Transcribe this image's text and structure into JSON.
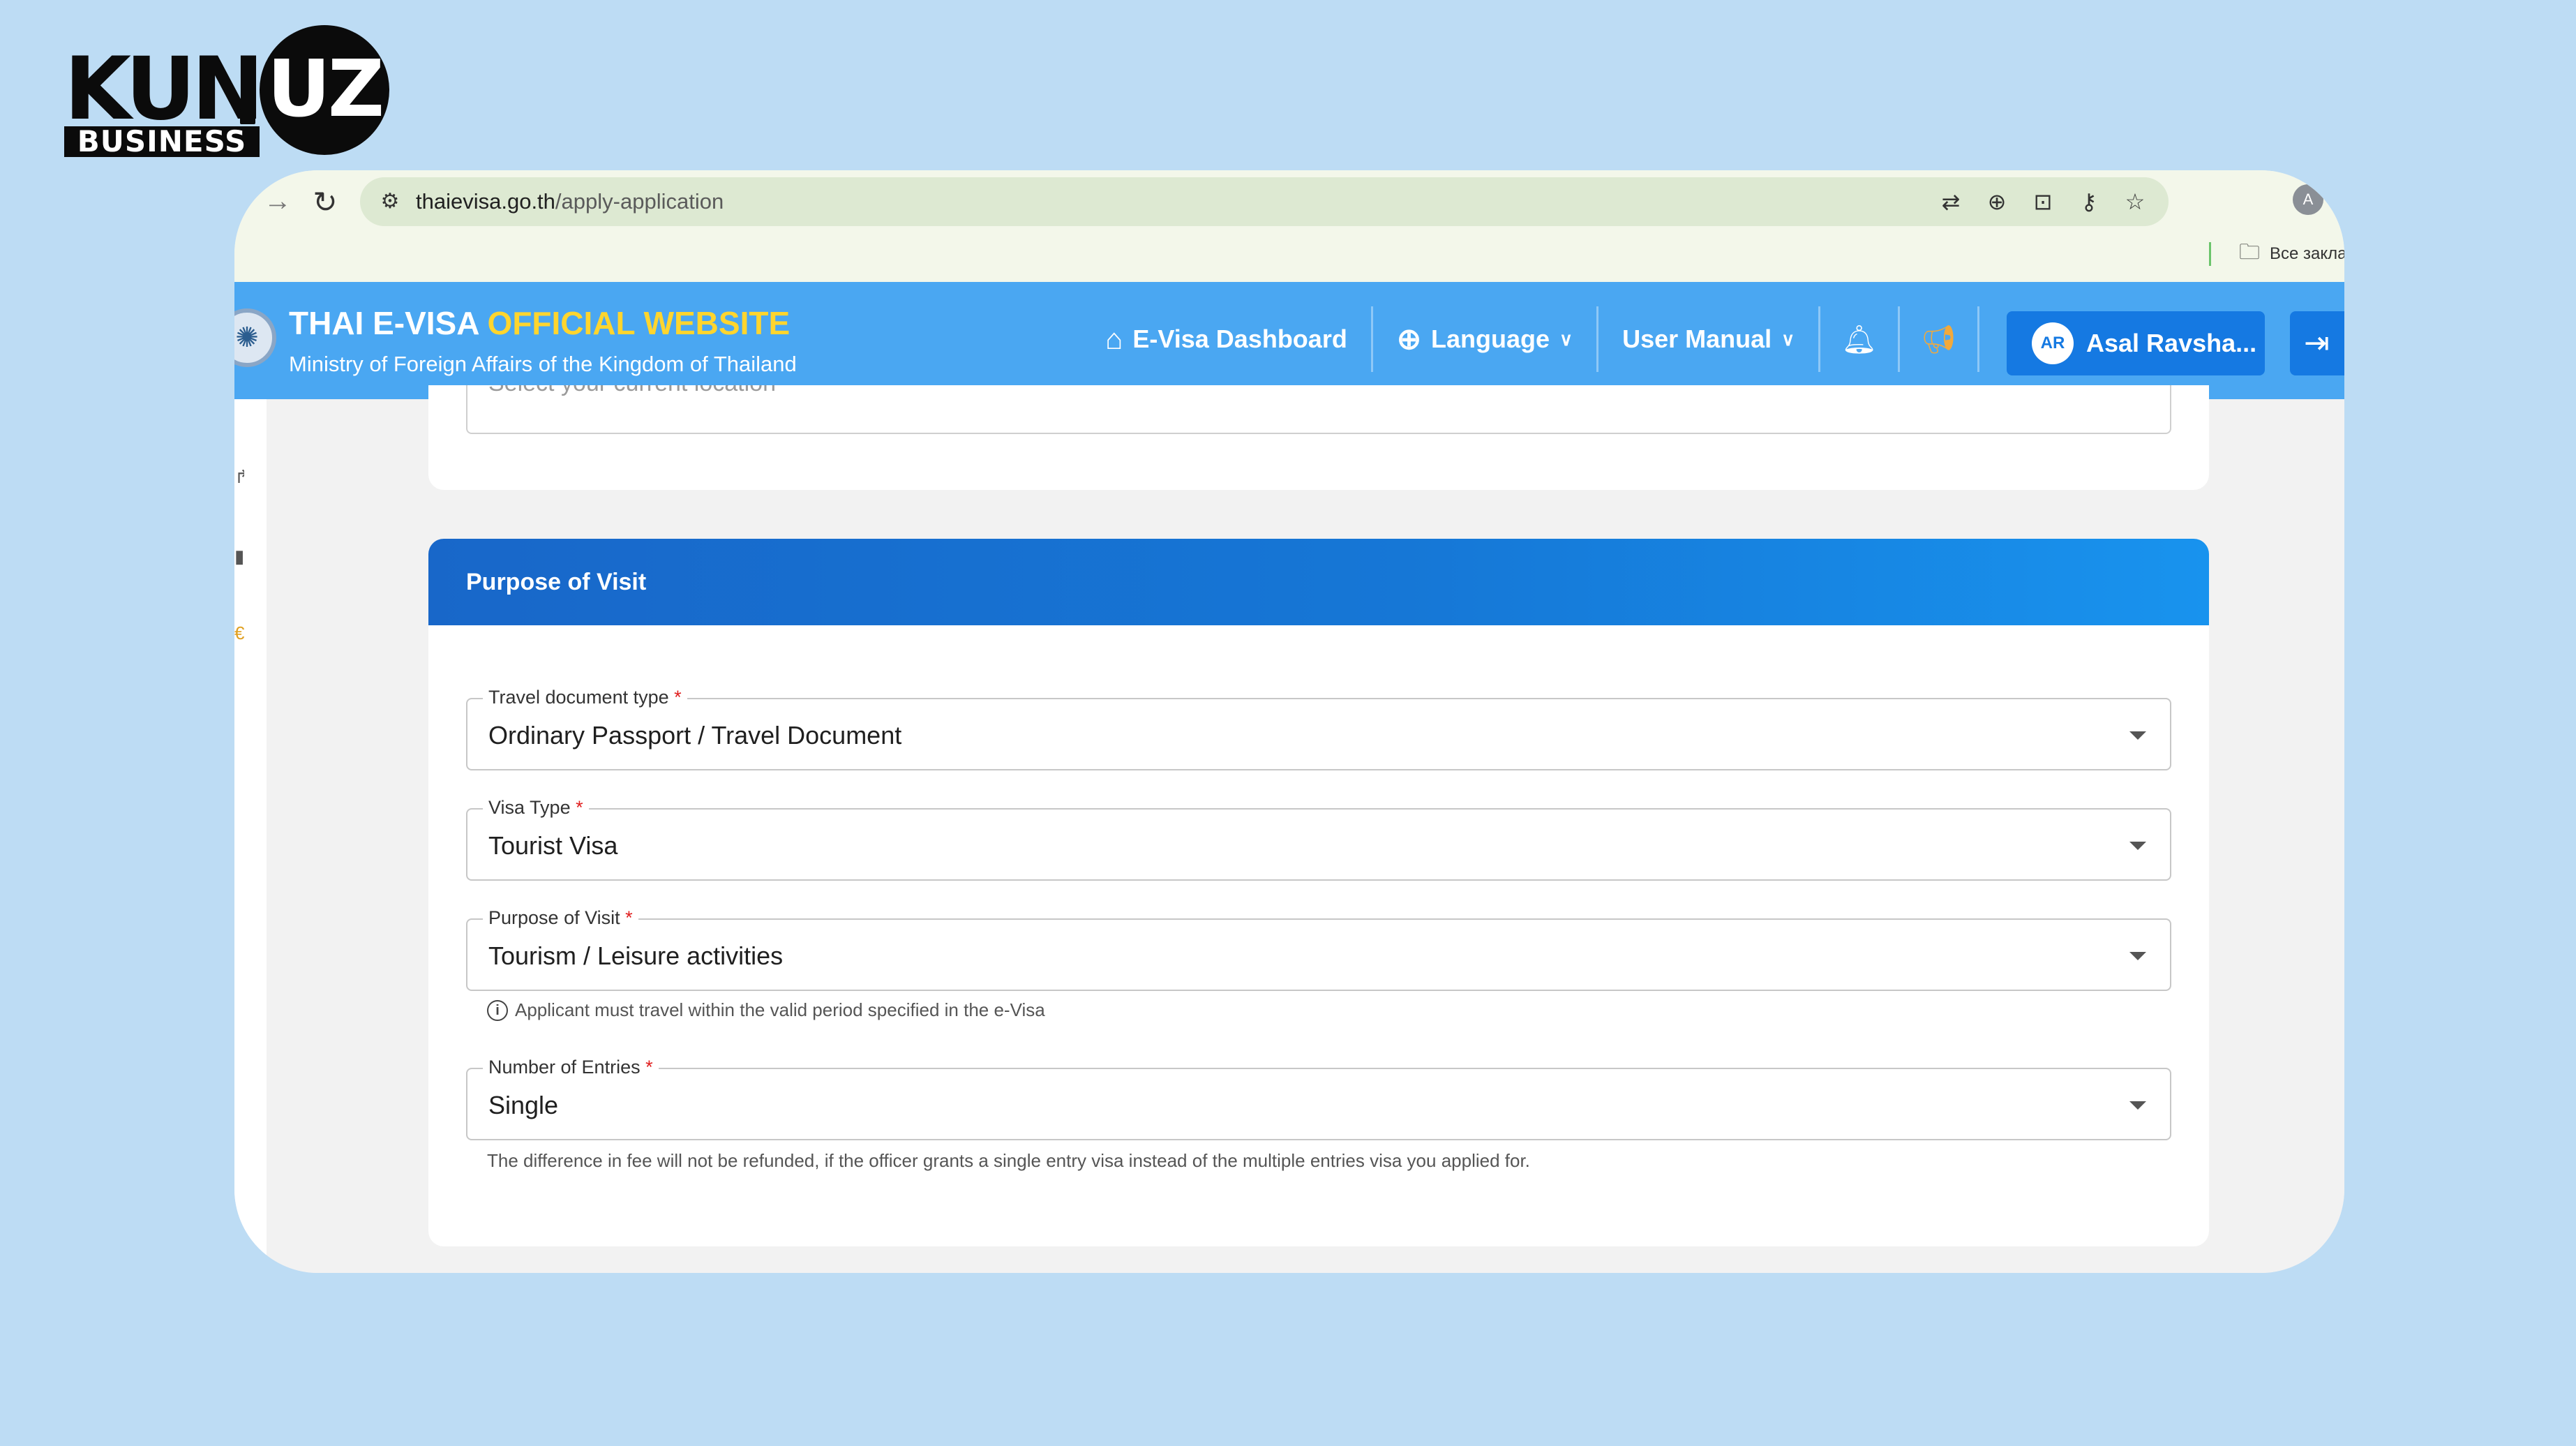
{
  "logo": {
    "kun": "KUN",
    "uz": "UZ",
    "business": "BUSINESS"
  },
  "browser": {
    "url_host": "thaievisa.go.th",
    "url_path": "/apply-application",
    "profile_initial": "A",
    "bookmark_label": "Все закла"
  },
  "header": {
    "title_part1": "THAI E-VISA ",
    "title_part2": "OFFICIAL WEBSITE",
    "subtitle": "Ministry of Foreign Affairs of the Kingdom of Thailand",
    "nav": {
      "dashboard": "E-Visa Dashboard",
      "language": "Language",
      "user_manual": "User Manual"
    },
    "user": {
      "initials": "AR",
      "name": "Asal Ravsha..."
    }
  },
  "location": {
    "placeholder": "Select your current location"
  },
  "purpose_section": {
    "title": "Purpose of Visit",
    "fields": [
      {
        "label": "Travel document type",
        "required": "*",
        "value": "Ordinary Passport / Travel Document"
      },
      {
        "label": "Visa Type",
        "required": "*",
        "value": "Tourist Visa"
      },
      {
        "label": "Purpose of Visit",
        "required": "*",
        "value": "Tourism / Leisure activities"
      },
      {
        "label": "Number of Entries",
        "required": "*",
        "value": "Single"
      }
    ],
    "purpose_hint": "Applicant must travel within the valid period specified in the e-Visa",
    "entries_hint": "The difference in fee will not be refunded, if the officer grants a single entry visa instead of the multiple entries visa you applied for."
  },
  "colors": {
    "page_bg": "#bddcf4",
    "header_bg": "#4aa7f2",
    "title_highlight": "#ffd52e",
    "section_header": "#1867c9",
    "primary_button": "#1579e2",
    "required": "#e02020"
  }
}
